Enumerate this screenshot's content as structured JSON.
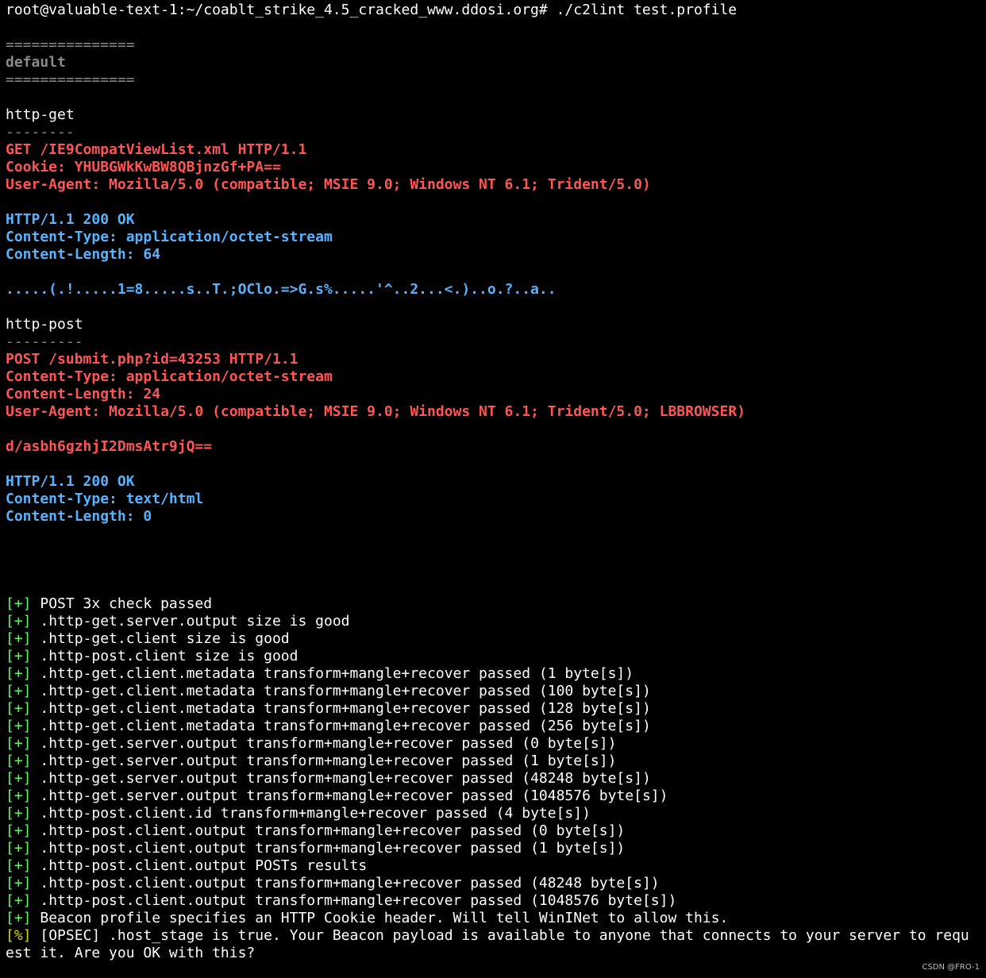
{
  "colors": {
    "background": "#000000",
    "plain": "#ffffff",
    "dim": "#8a8a8a",
    "request": "#ff5555",
    "response": "#55b3ff",
    "ok_marker": "#55ff55",
    "warn_marker": "#d7d700"
  },
  "prompt": {
    "text": "root@valuable-text-1:~/coablt_strike_4.5_cracked_www.ddosi.org# ./c2lint test.profile"
  },
  "header": {
    "rule": "===============",
    "title": "default"
  },
  "http_get": {
    "title": "http-get",
    "rule": "--------",
    "request": [
      "GET /IE9CompatViewList.xml HTTP/1.1",
      "Cookie: YHUBGWkKwBW8QBjnzGf+PA==",
      "User-Agent: Mozilla/5.0 (compatible; MSIE 9.0; Windows NT 6.1; Trident/5.0)"
    ],
    "response": [
      "HTTP/1.1 200 OK",
      "Content-Type: application/octet-stream",
      "Content-Length: 64"
    ],
    "body": ".....(.!.....1=8.....s..T.;OClo.=>G.s%.....'^..2...<.)..o.?..a.."
  },
  "http_post": {
    "title": "http-post",
    "rule": "---------",
    "request": [
      "POST /submit.php?id=43253 HTTP/1.1",
      "Content-Type: application/octet-stream",
      "Content-Length: 24",
      "User-Agent: Mozilla/5.0 (compatible; MSIE 9.0; Windows NT 6.1; Trident/5.0; LBBROWSER)"
    ],
    "body": "d/asbh6gzhjI2DmsAtr9jQ==",
    "response": [
      "HTTP/1.1 200 OK",
      "Content-Type: text/html",
      "Content-Length: 0"
    ]
  },
  "checks": {
    "ok_marker": "[+]",
    "warn_marker": "[%]",
    "items": [
      "POST 3x check passed",
      ".http-get.server.output size is good",
      ".http-get.client size is good",
      ".http-post.client size is good",
      ".http-get.client.metadata transform+mangle+recover passed (1 byte[s])",
      ".http-get.client.metadata transform+mangle+recover passed (100 byte[s])",
      ".http-get.client.metadata transform+mangle+recover passed (128 byte[s])",
      ".http-get.client.metadata transform+mangle+recover passed (256 byte[s])",
      ".http-get.server.output transform+mangle+recover passed (0 byte[s])",
      ".http-get.server.output transform+mangle+recover passed (1 byte[s])",
      ".http-get.server.output transform+mangle+recover passed (48248 byte[s])",
      ".http-get.server.output transform+mangle+recover passed (1048576 byte[s])",
      ".http-post.client.id transform+mangle+recover passed (4 byte[s])",
      ".http-post.client.output transform+mangle+recover passed (0 byte[s])",
      ".http-post.client.output transform+mangle+recover passed (1 byte[s])",
      ".http-post.client.output POSTs results",
      ".http-post.client.output transform+mangle+recover passed (48248 byte[s])",
      ".http-post.client.output transform+mangle+recover passed (1048576 byte[s])",
      "Beacon profile specifies an HTTP Cookie header. Will tell WinINet to allow this."
    ],
    "warning_line1": "[OPSEC] .host_stage is true. Your Beacon payload is available to anyone that connects to your server to requ",
    "warning_line2": "est it. Are you OK with this?"
  },
  "watermark": "CSDN @FRO-1"
}
